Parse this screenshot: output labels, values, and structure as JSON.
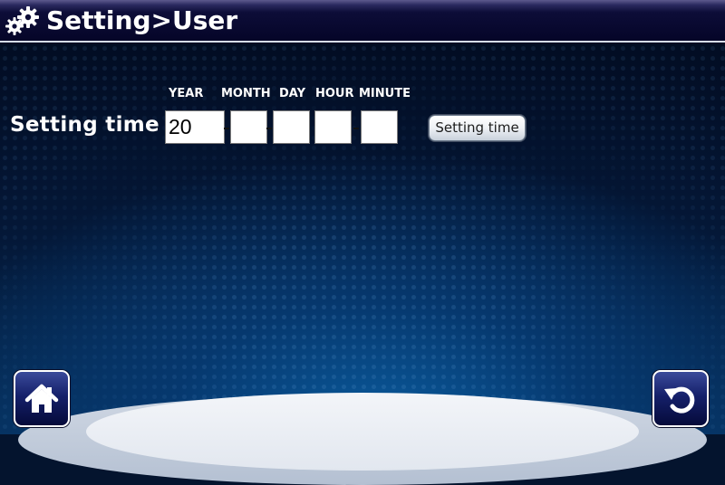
{
  "window": {
    "title": "Setting>User"
  },
  "time_setting": {
    "row_label": "Setting time",
    "columns": {
      "year": "YEAR",
      "month": "MONTH",
      "day": "DAY",
      "hour": "HOUR",
      "minute": "MINUTE"
    },
    "fields": {
      "year": "20",
      "month": "",
      "day": "",
      "hour": "",
      "minute": ""
    },
    "submit_label": "Setting time"
  },
  "navigation": {
    "home_icon": "home-icon",
    "back_icon": "back-arrow-icon"
  },
  "colors": {
    "title_bar": "#0d0d38",
    "background": "#04142e",
    "accent_glow": "#0a5a9c",
    "nav_button": "#15206a"
  }
}
